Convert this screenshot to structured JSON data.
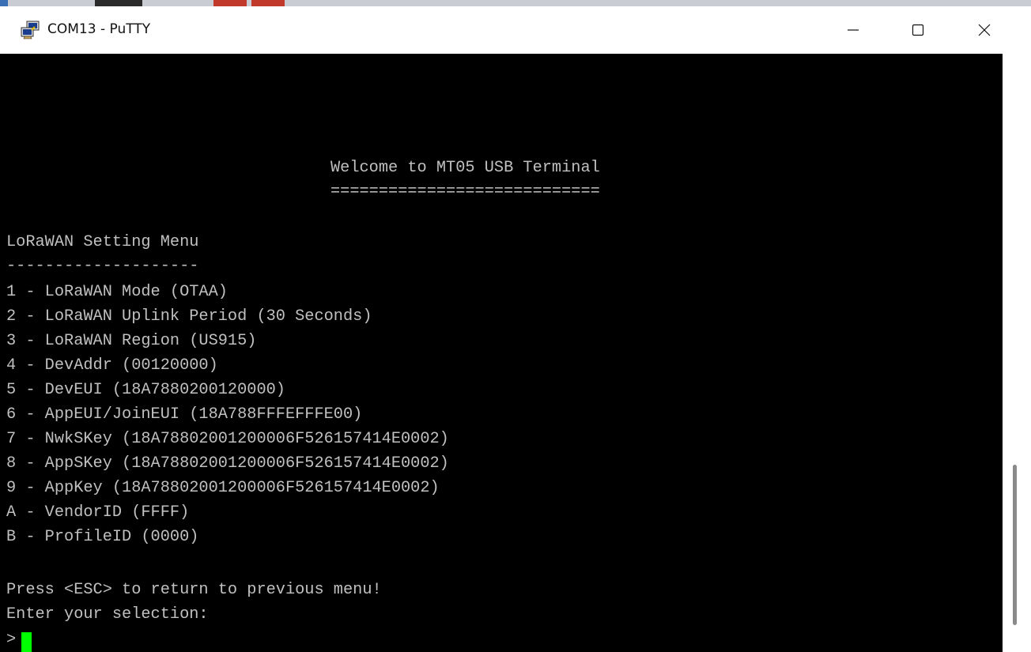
{
  "window": {
    "title": "COM13 - PuTTY",
    "icon": "putty-icon",
    "controls": [
      "minimize-icon",
      "maximize-icon",
      "close-icon"
    ]
  },
  "terminal": {
    "welcome": "Welcome to MT05 USB Terminal",
    "welcome_underline": "============================",
    "menu_title": "LoRaWAN Setting Menu",
    "menu_underline": "--------------------",
    "items": [
      "1 - LoRaWAN Mode (OTAA)",
      "2 - LoRaWAN Uplink Period (30 Seconds)",
      "3 - LoRaWAN Region (US915)",
      "4 - DevAddr (00120000)",
      "5 - DevEUI (18A7880200120000)",
      "6 - AppEUI/JoinEUI (18A788FFFEFFFE00)",
      "7 - NwkSKey (18A78802001200006F526157414E0002)",
      "8 - AppSKey (18A78802001200006F526157414E0002)",
      "9 - AppKey (18A78802001200006F526157414E0002)",
      "A - VendorID (FFFF)",
      "B - ProfileID (0000)"
    ],
    "esc_hint": "Press <ESC> to return to previous menu!",
    "prompt": "Enter your selection:",
    "prompt_char": ">"
  },
  "colors": {
    "terminal_bg": "#000000",
    "terminal_fg": "#c0c0c0",
    "cursor": "#00ff00"
  }
}
